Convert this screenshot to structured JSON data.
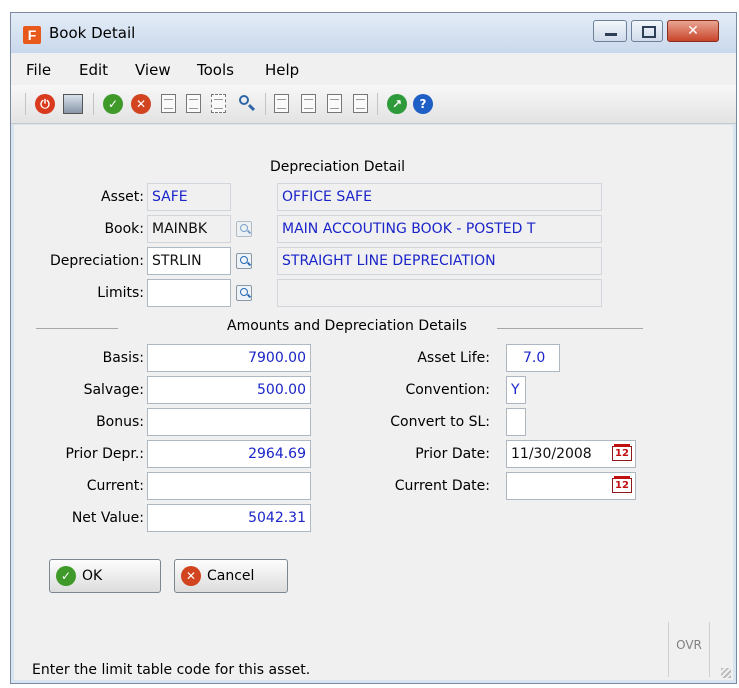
{
  "window": {
    "title": "Book Detail",
    "app_icon_letter": "F"
  },
  "menu": [
    "File",
    "Edit",
    "View",
    "Tools",
    "Help"
  ],
  "depreciation_detail": {
    "section_title": "Depreciation Detail",
    "asset": {
      "label": "Asset:",
      "code": "SAFE",
      "description": "OFFICE SAFE"
    },
    "book": {
      "label": "Book:",
      "code": "MAINBK",
      "description": "MAIN ACCOUTING BOOK - POSTED T"
    },
    "depreciation": {
      "label": "Depreciation:",
      "code": "STRLIN",
      "description": "STRAIGHT LINE DEPRECIATION"
    },
    "limits": {
      "label": "Limits:",
      "code": "",
      "description": ""
    }
  },
  "amounts": {
    "section_title": "Amounts and Depreciation Details",
    "basis": {
      "label": "Basis:",
      "value": "7900.00"
    },
    "salvage": {
      "label": "Salvage:",
      "value": "500.00"
    },
    "bonus": {
      "label": "Bonus:",
      "value": ""
    },
    "prior_depr": {
      "label": "Prior Depr.:",
      "value": "2964.69"
    },
    "current": {
      "label": "Current:",
      "value": ""
    },
    "net_value": {
      "label": "Net Value:",
      "value": "5042.31"
    },
    "asset_life": {
      "label": "Asset Life:",
      "value": "7.0"
    },
    "convention": {
      "label": "Convention:",
      "value": "Y"
    },
    "convert_to_sl": {
      "label": "Convert to SL:",
      "value": ""
    },
    "prior_date": {
      "label": "Prior Date:",
      "value": "11/30/2008"
    },
    "current_date": {
      "label": "Current Date:",
      "value": ""
    }
  },
  "buttons": {
    "ok": "OK",
    "cancel": "Cancel"
  },
  "status": {
    "message": "Enter the limit table code for this asset.",
    "mode": "OVR"
  },
  "colors": {
    "field_text": "#1a24c8",
    "accent": "#e85a1b"
  }
}
